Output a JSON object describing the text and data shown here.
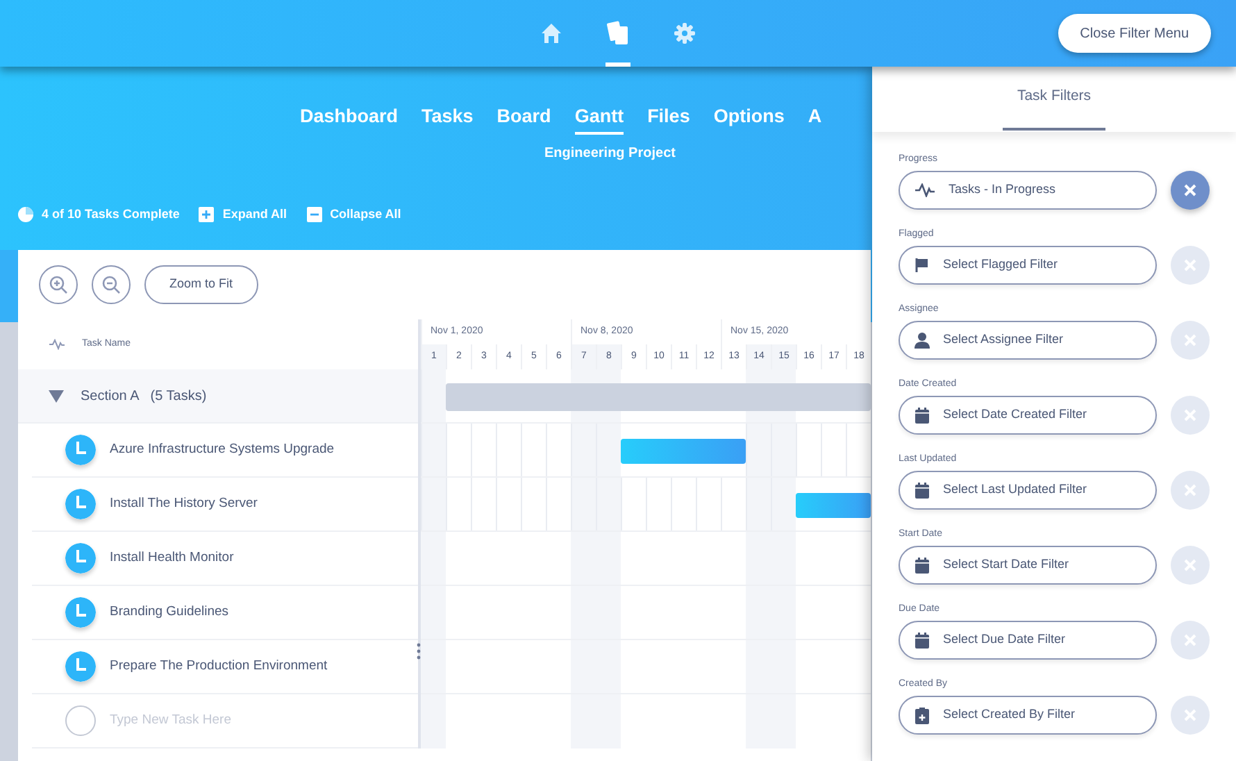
{
  "top_nav": {
    "icons": [
      {
        "kind": "home",
        "selected": false
      },
      {
        "kind": "cards",
        "selected": true
      },
      {
        "kind": "gear",
        "selected": false
      }
    ],
    "close_button": "Close Filter Menu"
  },
  "tabs": [
    {
      "label": "Dashboard",
      "selected": false
    },
    {
      "label": "Tasks",
      "selected": false
    },
    {
      "label": "Board",
      "selected": false
    },
    {
      "label": "Gantt",
      "selected": true
    },
    {
      "label": "Files",
      "selected": false
    },
    {
      "label": "Options",
      "selected": false
    },
    {
      "label": "A",
      "selected": false
    }
  ],
  "project_name": "Engineering Project",
  "summary": {
    "progress": "4 of 10 Tasks Complete",
    "expand": "Expand All",
    "collapse": "Collapse All"
  },
  "toolbar": {
    "zoom_fit": "Zoom to Fit"
  },
  "gantt": {
    "task_column": "Task Name",
    "weeks": [
      "Nov 1, 2020",
      "Nov 8, 2020",
      "Nov 15, 2020"
    ],
    "days": [
      {
        "label": "1",
        "weekend": true
      },
      {
        "label": "2",
        "weekend": false
      },
      {
        "label": "3",
        "weekend": false
      },
      {
        "label": "4",
        "weekend": false
      },
      {
        "label": "5",
        "weekend": false
      },
      {
        "label": "6",
        "weekend": false
      },
      {
        "label": "7",
        "weekend": true
      },
      {
        "label": "8",
        "weekend": true
      },
      {
        "label": "9",
        "weekend": false
      },
      {
        "label": "10",
        "weekend": false
      },
      {
        "label": "11",
        "weekend": false
      },
      {
        "label": "12",
        "weekend": false
      },
      {
        "label": "13",
        "weekend": false
      },
      {
        "label": "14",
        "weekend": true
      },
      {
        "label": "15",
        "weekend": true
      },
      {
        "label": "16",
        "weekend": false
      },
      {
        "label": "17",
        "weekend": false
      },
      {
        "label": "18",
        "weekend": false
      }
    ],
    "sections": [
      {
        "name": "Section A",
        "count": "(5 Tasks)",
        "expanded": true,
        "scheduled": [
          false,
          true,
          true,
          true,
          true,
          true,
          true,
          true,
          true,
          true,
          true,
          true,
          true,
          true,
          true,
          true,
          true,
          true
        ],
        "tasks": [
          {
            "name": "Azure Infrastructure Systems Upgrade",
            "scheduled": [
              false,
              false,
              false,
              false,
              false,
              false,
              false,
              false,
              true,
              true,
              true,
              true,
              true,
              false,
              false,
              false,
              false,
              false
            ]
          },
          {
            "name": "Install The History Server",
            "scheduled": [
              false,
              false,
              false,
              false,
              false,
              false,
              false,
              false,
              false,
              false,
              false,
              false,
              false,
              false,
              false,
              true,
              true,
              true
            ]
          },
          {
            "name": "Install Health Monitor"
          },
          {
            "name": "Branding Guidelines"
          },
          {
            "name": "Prepare The Production Environment"
          }
        ]
      }
    ],
    "new_task_placeholder": "Type New Task Here"
  },
  "filter_panel": {
    "title": "Task Filters",
    "filters": [
      {
        "label": "Progress",
        "kind": "pulse",
        "value": "Tasks - In Progress",
        "active": true
      },
      {
        "label": "Flagged",
        "kind": "flag",
        "placeholder": "Select Flagged Filter",
        "active": false
      },
      {
        "label": "Assignee",
        "kind": "person",
        "placeholder": "Select Assignee Filter",
        "active": false
      },
      {
        "label": "Date Created",
        "kind": "calendar",
        "placeholder": "Select Date Created Filter",
        "active": false
      },
      {
        "label": "Last Updated",
        "kind": "calendar",
        "placeholder": "Select Last Updated Filter",
        "active": false
      },
      {
        "label": "Start Date",
        "kind": "calendar",
        "placeholder": "Select Start Date Filter",
        "active": false
      },
      {
        "label": "Due Date",
        "kind": "calendar",
        "placeholder": "Select Due Date Filter",
        "active": false
      },
      {
        "label": "Created By",
        "kind": "clipboard",
        "placeholder": "Select Created By Filter",
        "active": false
      }
    ]
  }
}
